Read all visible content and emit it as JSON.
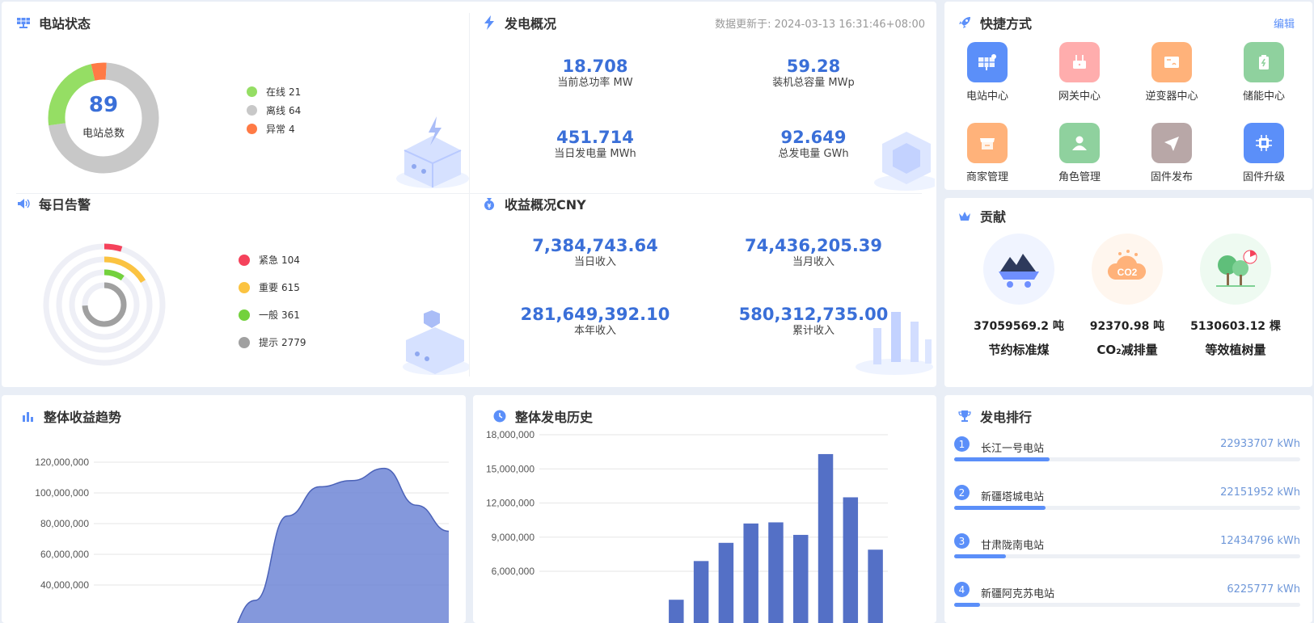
{
  "station_status": {
    "title": "电站状态",
    "total": "89",
    "total_label": "电站总数",
    "legend": [
      {
        "label": "在线",
        "count": "21",
        "value": 21,
        "color": "#95de64"
      },
      {
        "label": "离线",
        "count": "64",
        "value": 64,
        "color": "#c8c8c8"
      },
      {
        "label": "异常",
        "count": "4",
        "value": 4,
        "color": "#ff7a45"
      }
    ]
  },
  "power_overview": {
    "title": "发电概况",
    "update": "数据更新于: 2024-03-13 16:31:46+08:00",
    "stats": [
      {
        "value": "18.708",
        "label": "当前总功率 MW"
      },
      {
        "value": "59.28",
        "label": "装机总容量 MWp"
      },
      {
        "value": "451.714",
        "label": "当日发电量 MWh"
      },
      {
        "value": "92.649",
        "label": "总发电量 GWh"
      }
    ]
  },
  "quick_access": {
    "title": "快捷方式",
    "edit": "编辑",
    "items": [
      {
        "label": "电站中心",
        "color": "#5b8ff9",
        "icon": "solar-panel-icon"
      },
      {
        "label": "网关中心",
        "color": "#ffadad",
        "icon": "router-icon"
      },
      {
        "label": "逆变器中心",
        "color": "#ffb27a",
        "icon": "inverter-icon"
      },
      {
        "label": "储能中心",
        "color": "#8fd19e",
        "icon": "battery-icon"
      },
      {
        "label": "商家管理",
        "color": "#ffb27a",
        "icon": "store-icon"
      },
      {
        "label": "角色管理",
        "color": "#8fd19e",
        "icon": "user-icon"
      },
      {
        "label": "固件发布",
        "color": "#b8a7a7",
        "icon": "send-icon"
      },
      {
        "label": "固件升级",
        "color": "#5b8ff9",
        "icon": "chip-icon"
      }
    ]
  },
  "daily_alarm": {
    "title": "每日告警",
    "legend": [
      {
        "label": "紧急",
        "count": "104",
        "value": 104,
        "color": "#f5425b"
      },
      {
        "label": "重要",
        "count": "615",
        "value": 615,
        "color": "#fbc341"
      },
      {
        "label": "一般",
        "count": "361",
        "value": 361,
        "color": "#73d13d"
      },
      {
        "label": "提示",
        "count": "2779",
        "value": 2779,
        "color": "#a0a0a0"
      }
    ]
  },
  "revenue_overview": {
    "title": "收益概况CNY",
    "stats": [
      {
        "value": "7,384,743.64",
        "label": "当日收入"
      },
      {
        "value": "74,436,205.39",
        "label": "当月收入"
      },
      {
        "value": "281,649,392.10",
        "label": "本年收入"
      },
      {
        "value": "580,312,735.00",
        "label": "累计收入"
      }
    ]
  },
  "contribution": {
    "title": "贡献",
    "items": [
      {
        "value": "37059569.2 吨",
        "name": "节约标准煤",
        "icon": "coal-icon"
      },
      {
        "value": "92370.98 吨",
        "name": "CO₂减排量",
        "icon": "co2-cloud-icon"
      },
      {
        "value": "5130603.12 棵",
        "name": "等效植树量",
        "icon": "tree-icon"
      }
    ]
  },
  "revenue_trend": {
    "title": "整体收益趋势",
    "chart_data": {
      "type": "area",
      "yticks": [
        "120,000,000",
        "100,000,000",
        "80,000,000",
        "60,000,000",
        "40,000,000"
      ],
      "ytick_values": [
        120000000,
        100000000,
        80000000,
        60000000,
        40000000
      ],
      "ylim": [
        0,
        130000000
      ],
      "x": [
        0,
        1,
        2,
        3,
        4,
        5,
        6,
        7,
        8,
        9,
        10,
        11
      ],
      "values": [
        0,
        0,
        0,
        0,
        0,
        30000000,
        85000000,
        104000000,
        108000000,
        116000000,
        92000000,
        75000000
      ],
      "color": "#6f86d6"
    }
  },
  "power_history": {
    "title": "整体发电历史",
    "chart_data": {
      "type": "bar",
      "yticks": [
        "18,000,000",
        "15,000,000",
        "12,000,000",
        "9,000,000",
        "6,000,000"
      ],
      "ytick_values": [
        18000000,
        15000000,
        12000000,
        9000000,
        6000000
      ],
      "ylim": [
        0,
        19000000
      ],
      "values": [
        0,
        0,
        0,
        0,
        0,
        3500000,
        6900000,
        8500000,
        10200000,
        10300000,
        9200000,
        16300000,
        12500000,
        7900000
      ],
      "color": "#5470c6"
    }
  },
  "ranking": {
    "title": "发电排行",
    "items": [
      {
        "rank": "1",
        "name": "长江一号电站",
        "value": "22933707 kWh",
        "ratio": 0.275
      },
      {
        "rank": "2",
        "name": "新疆塔城电站",
        "value": "22151952 kWh",
        "ratio": 0.265
      },
      {
        "rank": "3",
        "name": "甘肃陇南电站",
        "value": "12434796 kWh",
        "ratio": 0.15
      },
      {
        "rank": "4",
        "name": "新疆阿克苏电站",
        "value": "6225777 kWh",
        "ratio": 0.075
      }
    ]
  }
}
